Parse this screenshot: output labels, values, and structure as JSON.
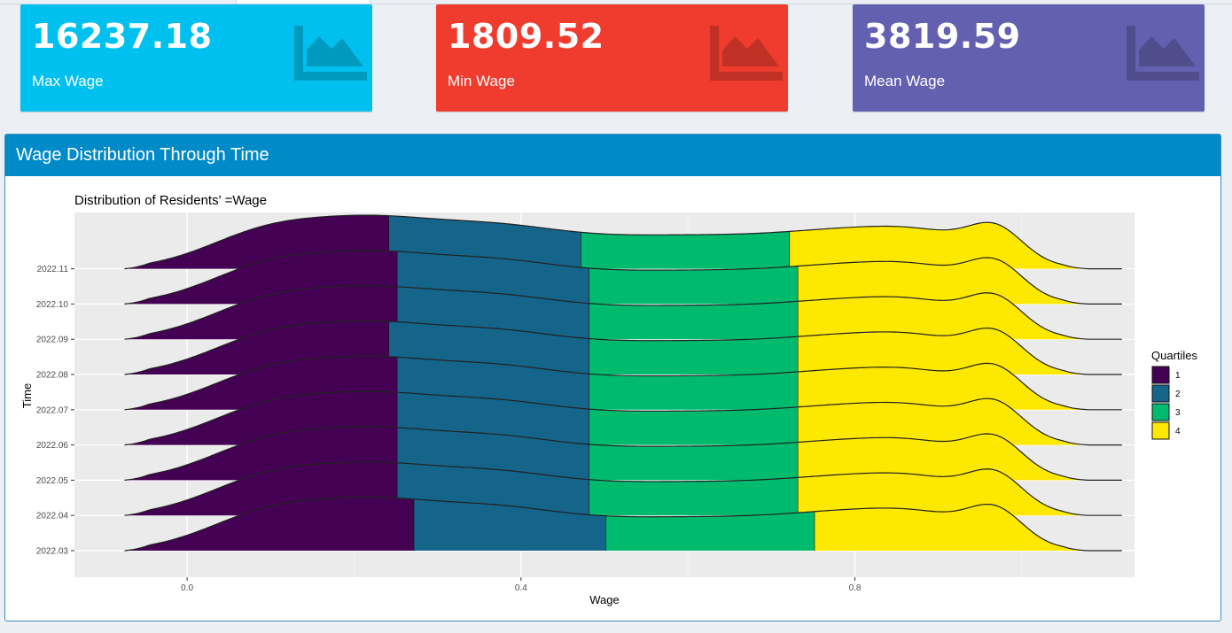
{
  "tabs_strip": {},
  "value_boxes": [
    {
      "value": "16237.18",
      "label": "Max Wage",
      "color": "#00c0ef",
      "icon": "area-chart-icon"
    },
    {
      "value": "1809.52",
      "label": "Min Wage",
      "color": "#f03c2e",
      "icon": "area-chart-icon"
    },
    {
      "value": "3819.59",
      "label": "Mean Wage",
      "color": "#6460b0",
      "icon": "area-chart-icon"
    }
  ],
  "panel": {
    "title": "Wage Distribution Through Time"
  },
  "chart_data": {
    "type": "ridgeline",
    "title": "Distribution of Residents' =Wage",
    "xlabel": "Wage",
    "ylabel": "Time",
    "x_ticks": [
      0.0,
      0.4,
      0.8
    ],
    "x_tick_labels": [
      "0.0",
      "0.4",
      "0.8"
    ],
    "xlim": [
      -0.135,
      1.135
    ],
    "y_labels": [
      "2022.03",
      "2022.04",
      "2022.05",
      "2022.06",
      "2022.07",
      "2022.08",
      "2022.09",
      "2022.10",
      "2022.11"
    ],
    "grid": true,
    "legend": {
      "title": "Quartiles",
      "position": "right",
      "entries": [
        "1",
        "2",
        "3",
        "4"
      ]
    },
    "quartile_colors": [
      "#440154",
      "#15648a",
      "#00bb6e",
      "#fde800"
    ],
    "density_range": [
      -0.075,
      1.08
    ],
    "quartile_cutoffs": [
      [
        0.272,
        0.502,
        0.752
      ],
      [
        0.252,
        0.482,
        0.732
      ],
      [
        0.252,
        0.482,
        0.732
      ],
      [
        0.252,
        0.482,
        0.732
      ],
      [
        0.252,
        0.482,
        0.732
      ],
      [
        0.242,
        0.482,
        0.732
      ],
      [
        0.252,
        0.482,
        0.732
      ],
      [
        0.252,
        0.482,
        0.732
      ],
      [
        0.242,
        0.472,
        0.722
      ]
    ]
  }
}
